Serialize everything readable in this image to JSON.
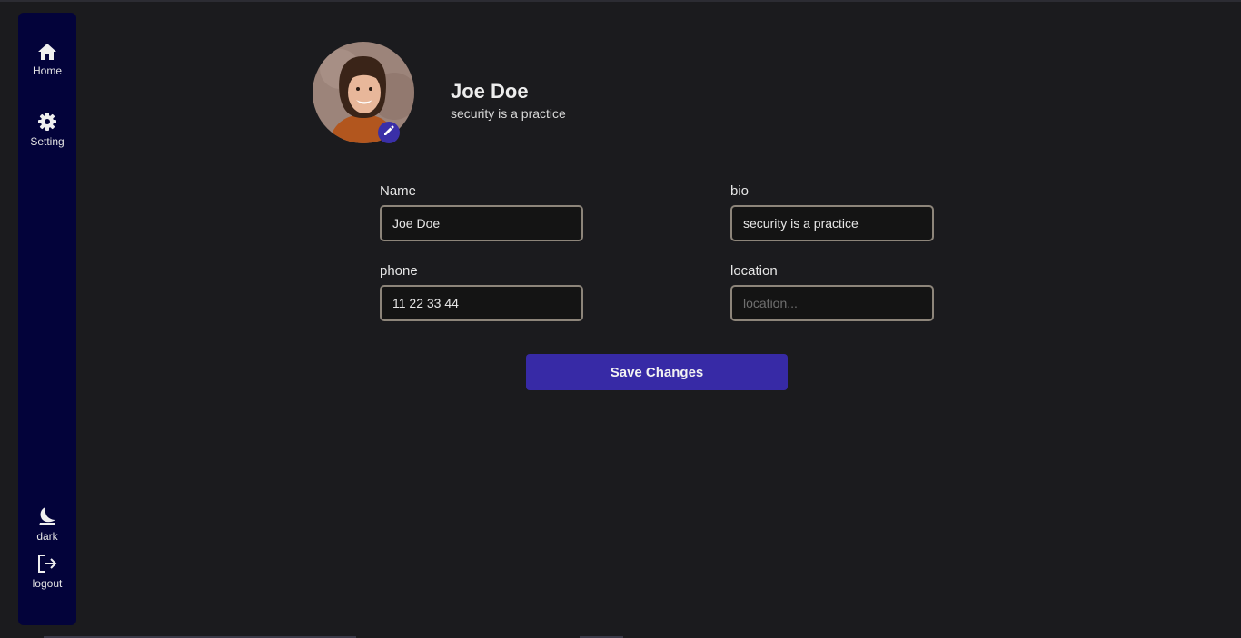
{
  "sidebar": {
    "home_label": "Home",
    "setting_label": "Setting",
    "theme_label": "dark",
    "logout_label": "logout"
  },
  "profile": {
    "name": "Joe Doe",
    "bio": "security is a practice"
  },
  "form": {
    "name_label": "Name",
    "name_value": "Joe Doe",
    "bio_label": "bio",
    "bio_value": "security is a practice",
    "phone_label": "phone",
    "phone_value": "11 22 33 44",
    "location_label": "location",
    "location_value": "",
    "location_placeholder": "location..."
  },
  "actions": {
    "save_label": "Save Changes"
  },
  "colors": {
    "background": "#1b1b1e",
    "sidebar": "#03033a",
    "accent": "#372aa6",
    "input_border": "#8d857a"
  },
  "icons": {
    "home": "home-icon",
    "setting": "gear-icon",
    "theme": "moon-icon",
    "logout": "logout-icon",
    "edit": "pencil-icon"
  }
}
